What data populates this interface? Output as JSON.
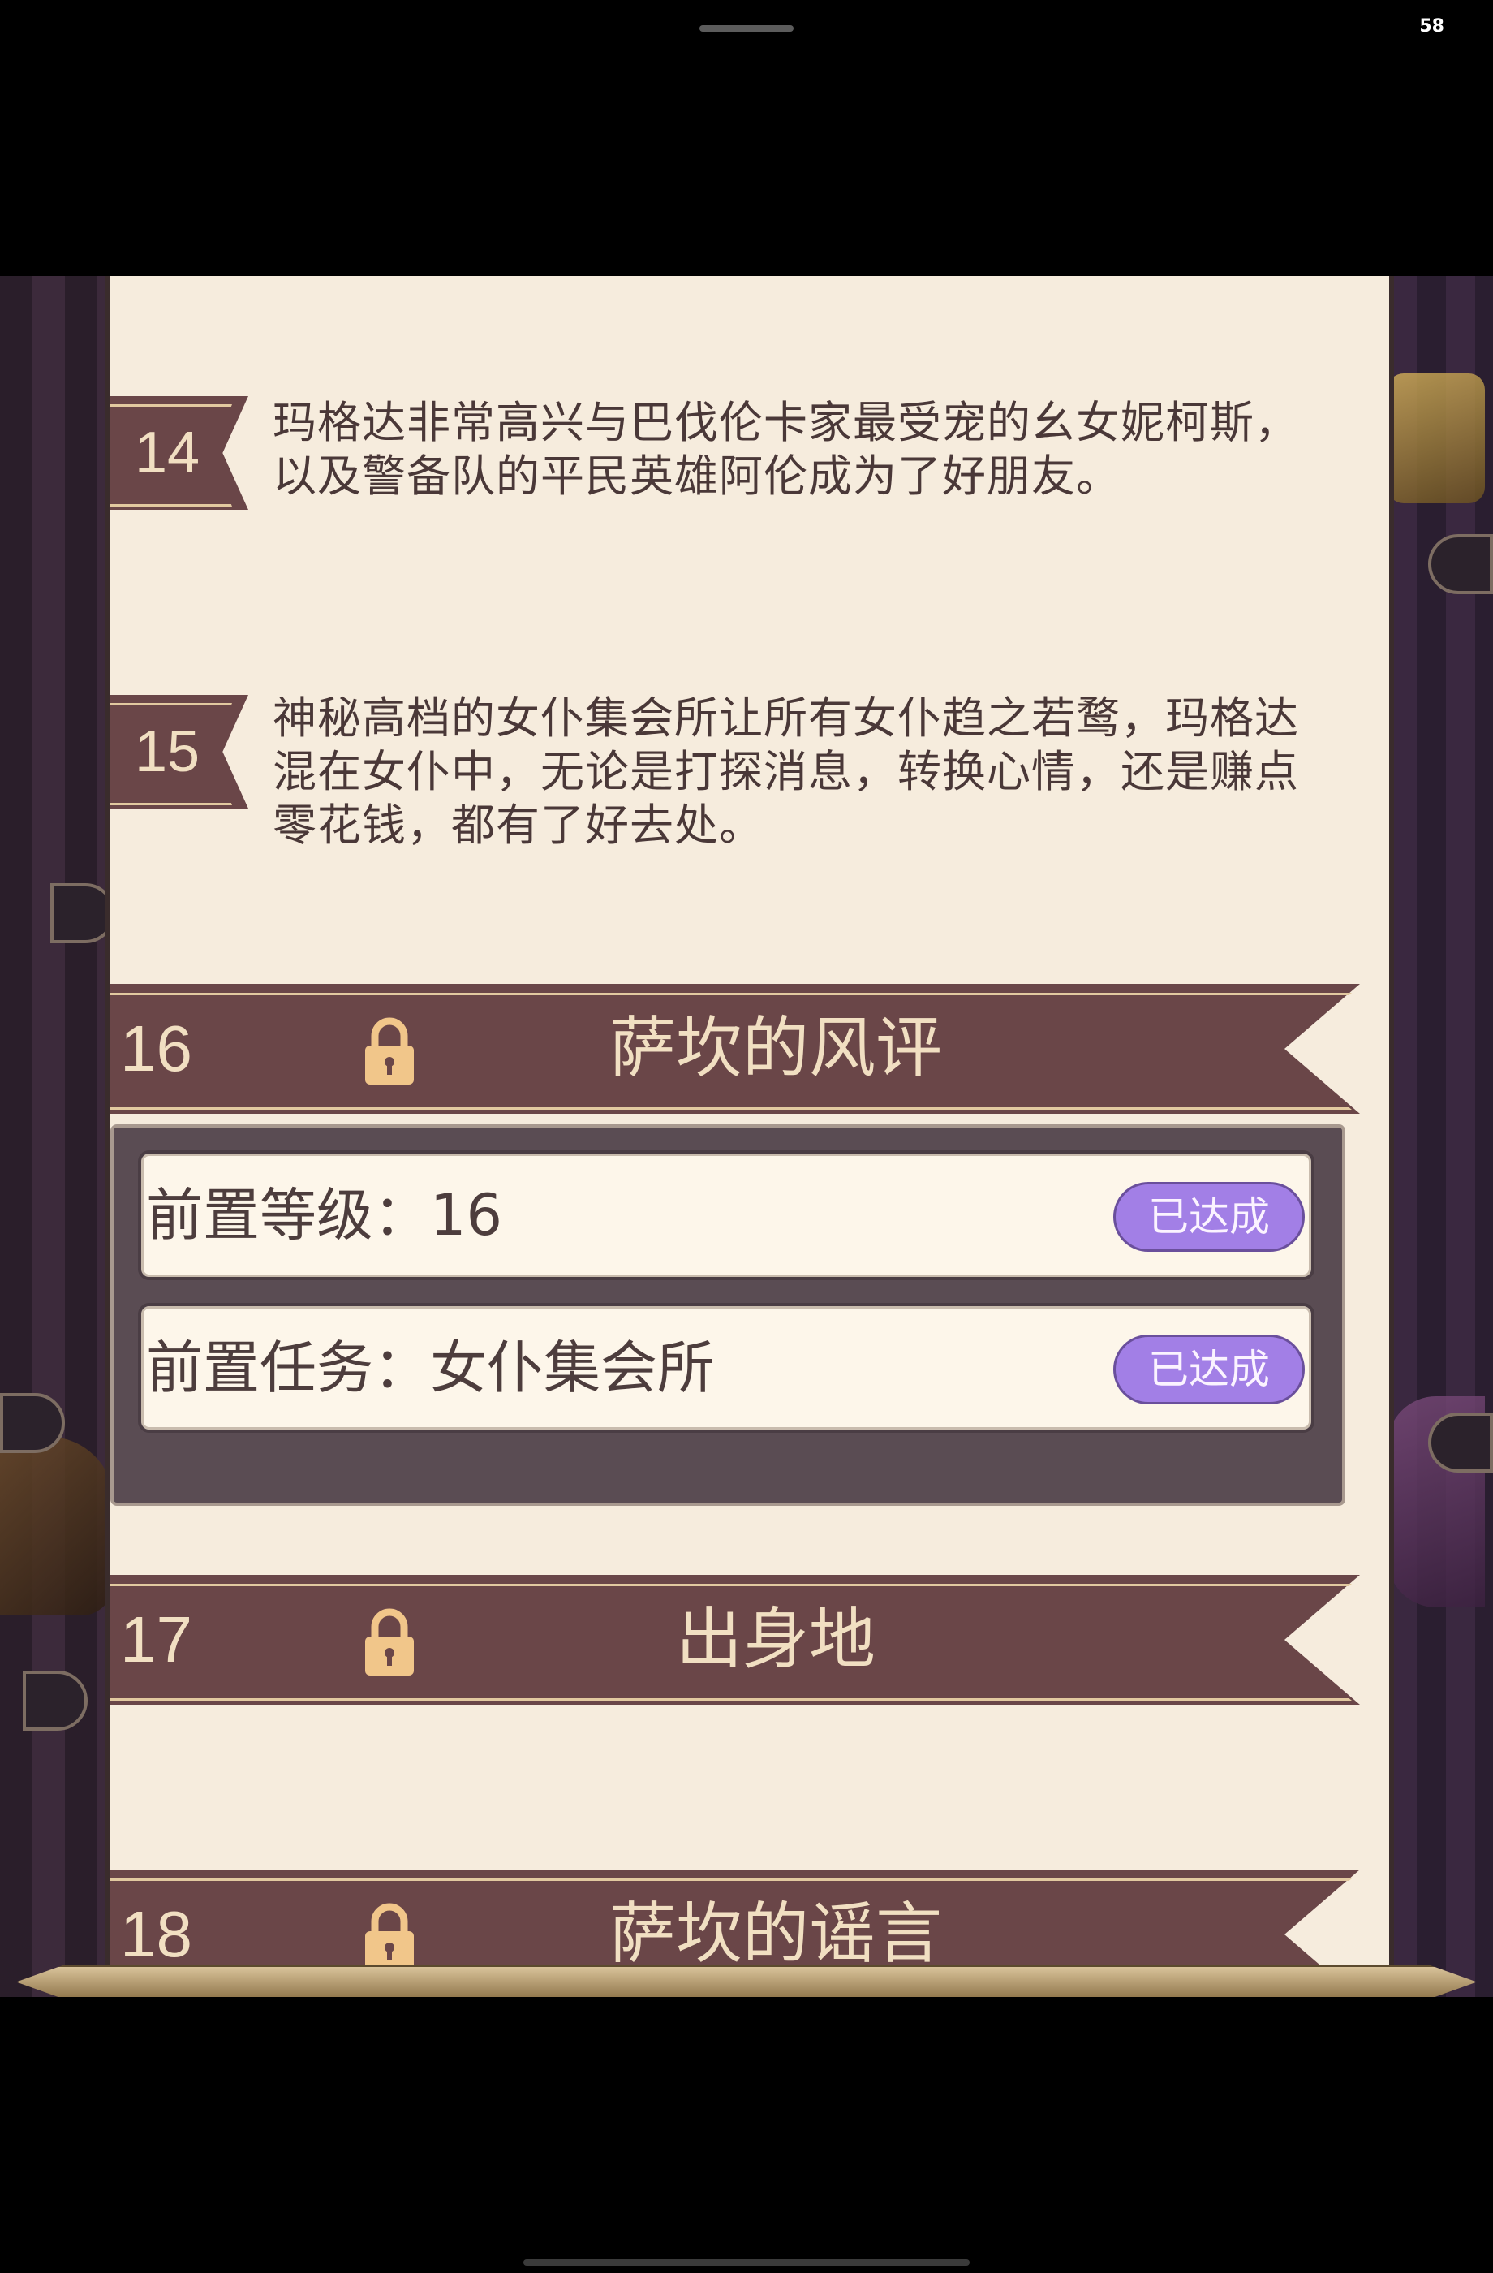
{
  "status_bar": {
    "right_value": "58"
  },
  "entries": [
    {
      "number": "14",
      "text": "玛格达非常高兴与巴伐伦卡家最受宠的幺女妮柯斯，以及警备队的平民英雄阿伦成为了好朋友。"
    },
    {
      "number": "15",
      "text": "神秘高档的女仆集会所让所有女仆趋之若鹜，玛格达混在女仆中，无论是打探消息，转换心情，还是赚点零花钱，都有了好去处。"
    }
  ],
  "sections": [
    {
      "number": "16",
      "title": "萨坎的风评",
      "icon": "lock-icon",
      "requirements": [
        {
          "label": "前置等级：16",
          "status": "已达成"
        },
        {
          "label": "前置任务：女仆集会所",
          "status": "已达成"
        }
      ]
    },
    {
      "number": "17",
      "title": "出身地",
      "icon": "lock-icon"
    },
    {
      "number": "18",
      "title": "萨坎的谣言",
      "icon": "lock-icon"
    }
  ],
  "colors": {
    "banner": "#6a4648",
    "banner_text": "#f1dfc2",
    "panel": "#f6ecdd",
    "status_pill": "#a27fe6"
  }
}
